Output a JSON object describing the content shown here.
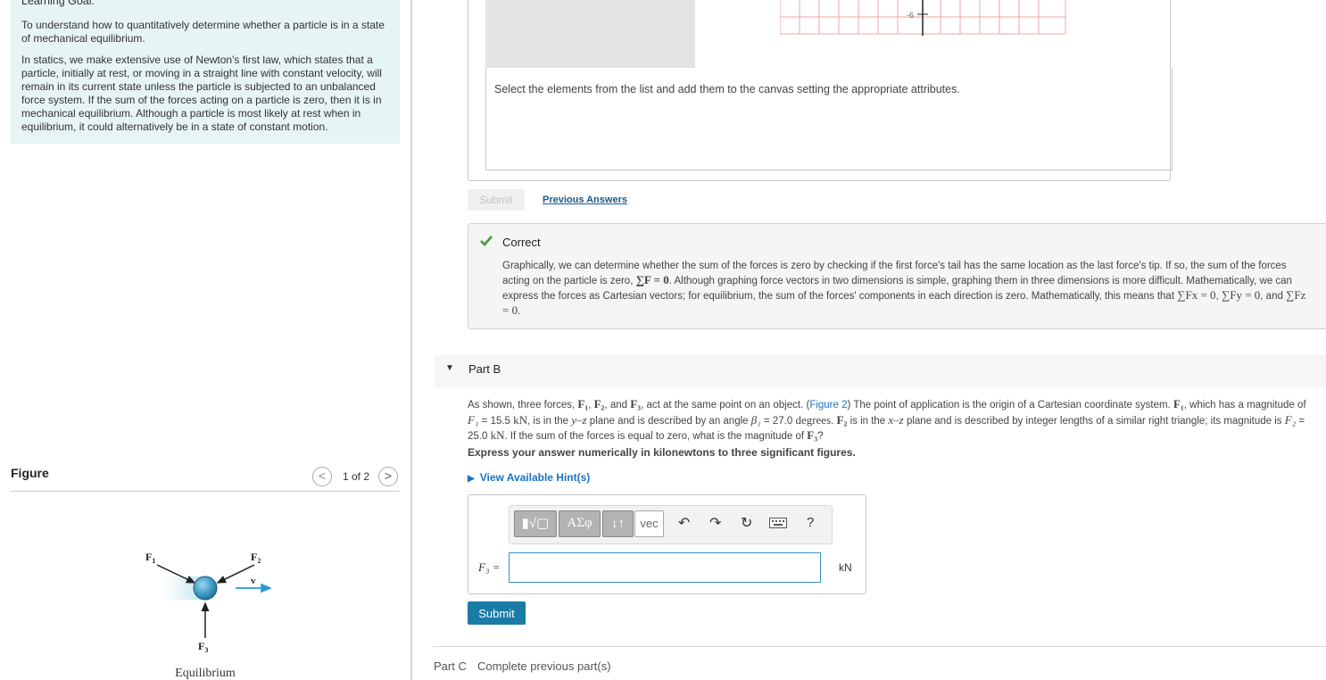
{
  "learning_goal": {
    "title": "Learning Goal:",
    "paragraph1": "To understand how to quantitatively determine whether a particle is in a state of mechanical equilibrium.",
    "paragraph2": "In statics, we make extensive use of Newton's first law, which states that a particle, initially at rest, or moving in a straight line with constant velocity, will remain in its current state unless the particle is subjected to an unbalanced force system. If the sum of the forces acting on a particle is zero, then it is in mechanical equilibrium. Although a particle is most likely at rest when in equilibrium, it could alternatively be in a state of constant motion."
  },
  "figure": {
    "label": "Figure",
    "counter": "1 of 2",
    "prev_icon": "<",
    "next_icon": ">",
    "labels": {
      "f1": "F",
      "f1_sub": "1",
      "f2": "F",
      "f2_sub": "2",
      "f3": "F",
      "f3_sub": "3",
      "v": "v"
    },
    "caption": "Equilibrium"
  },
  "part_a": {
    "graph_tick": "-6",
    "canvas_instruction": "Select the elements from the list and add them to the canvas setting the appropriate attributes.",
    "submit_label": "Submit",
    "previous_answers": "Previous Answers",
    "feedback_status": "Correct",
    "feedback": {
      "s1": "Graphically, we can determine whether the sum of the forces is zero by checking if the first force's tail has the same location as the last force's tip. If so, the sum of the forces acting on the particle is zero, ",
      "eq1": "∑F = 0",
      "s2": ". Although graphing force vectors in two dimensions is simple, graphing them in three dimensions is more difficult. Mathematically, we can express the forces as Cartesian vectors; for equilibrium, the sum of the forces' components in each direction is zero. Mathematically, this means that ",
      "eqx": "∑Fx = 0",
      "comma": ", ",
      "eqy": "∑Fy = 0",
      "and": ", and ",
      "eqz": "∑Fz = 0",
      "end": "."
    }
  },
  "part_b": {
    "title": "Part B",
    "problem": {
      "t1": "As shown, three forces, ",
      "f1": "F₁",
      "c1": ", ",
      "f2": "F₂",
      "t2": ", and ",
      "f3": "F₃",
      "t3": ", act at the same point on an object. (",
      "fig_link": "Figure 2",
      "t4": ") The point of application is the origin of a Cartesian coordinate system. ",
      "f1b": "F₁",
      "t5": ", which has a magnitude of ",
      "F1": "F₁",
      "t6": " = 15.5 ",
      "kn1": "kN",
      "t7": ", is in the ",
      "yz": "y–z",
      "t8": " plane and is described by an angle ",
      "beta": "β₁",
      "t9": " = 27.0 ",
      "deg": "degrees",
      "t10": ". ",
      "f2b": "F₂",
      "t11": " is in the ",
      "xz": "x–z",
      "t12": " plane and is described by integer lengths of a similar right triangle; its magnitude is ",
      "F2": "F₂",
      "t13": " = 25.0 ",
      "kn2": "kN",
      "t14": ". If the sum of the forces is equal to zero, what is the magnitude of ",
      "f3b": "F₃",
      "t15": "?"
    },
    "instruction": "Express your answer numerically in kilonewtons to three significant figures.",
    "hints_link": "View Available Hint(s)",
    "toolbar": {
      "templates": "▮√▢",
      "greek": "ΑΣφ",
      "arrows": "↓↑",
      "vec": "vec",
      "undo": "↶",
      "redo": "↷",
      "reset": "↻",
      "help": "?"
    },
    "answer_label": "F₃ =",
    "answer_value": "",
    "unit": "kN",
    "submit_label": "Submit"
  },
  "part_c": {
    "label": "Part C",
    "status": "Complete previous part(s)"
  }
}
